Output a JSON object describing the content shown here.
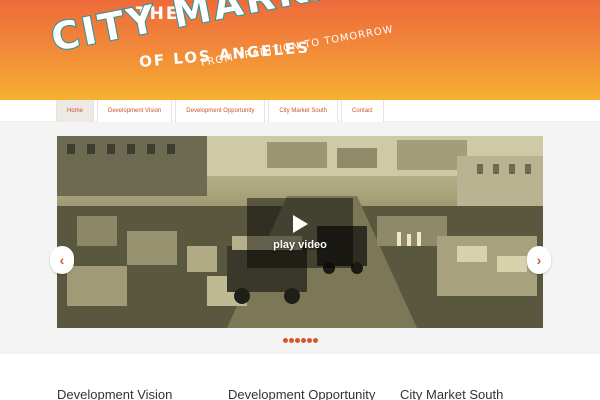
{
  "logo": {
    "the": "THE",
    "city_market": "CITY MARKET",
    "of_los_angeles": "OF LOS ANGELES",
    "tagline": "FROM TRADITION TO TOMORROW"
  },
  "nav": {
    "items": [
      {
        "label": "Home"
      },
      {
        "label": "Development Vision"
      },
      {
        "label": "Development Opportunity"
      },
      {
        "label": "City Market South"
      },
      {
        "label": "Contact"
      }
    ]
  },
  "slider": {
    "play_label": "play video",
    "dot_count": 6
  },
  "columns": {
    "titles": [
      "Development Vision",
      "Development Opportunity",
      "City Market South"
    ]
  },
  "colors": {
    "accent": "#d2582c",
    "header_top": "#ee6b3b",
    "header_bottom": "#f6b031",
    "logo_outline": "#1f9aa0"
  }
}
